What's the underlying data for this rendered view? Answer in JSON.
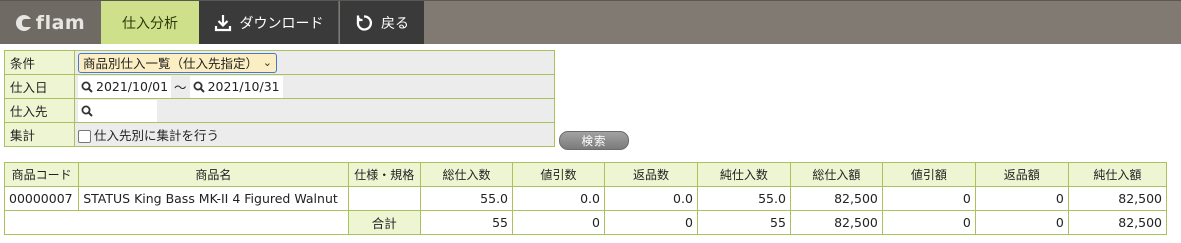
{
  "header": {
    "brand": "flam",
    "tabs": [
      {
        "label": "仕入分析",
        "active": true
      },
      {
        "label": "ダウンロード",
        "icon": "download-icon"
      },
      {
        "label": "戻る",
        "icon": "refresh-icon"
      }
    ]
  },
  "filter": {
    "condition_label": "条件",
    "condition_value": "商品別仕入一覧（仕入先指定）",
    "date_label": "仕入日",
    "date_from": "2021/10/01",
    "date_sep": "〜",
    "date_to": "2021/10/31",
    "supplier_label": "仕入先",
    "supplier_value": "",
    "aggregate_label": "集計",
    "aggregate_checkbox_label": "仕入先別に集計を行う",
    "aggregate_checked": false,
    "search_button": "検索"
  },
  "results": {
    "columns": [
      "商品コード",
      "商品名",
      "仕様・規格",
      "総仕入数",
      "値引数",
      "返品数",
      "純仕入数",
      "総仕入額",
      "値引額",
      "返品額",
      "純仕入額"
    ],
    "rows": [
      {
        "code": "00000007",
        "name": "STATUS King Bass MK-II 4 Figured Walnut",
        "spec": "",
        "total_qty": "55.0",
        "discount_qty": "0.0",
        "return_qty": "0.0",
        "net_qty": "55.0",
        "total_amount": "82,500",
        "discount_amount": "0",
        "return_amount": "0",
        "net_amount": "82,500"
      }
    ],
    "total": {
      "label": "合計",
      "total_qty": "55",
      "discount_qty": "0",
      "return_qty": "0",
      "net_qty": "55",
      "total_amount": "82,500",
      "discount_amount": "0",
      "return_amount": "0",
      "net_amount": "82,500"
    }
  },
  "colors": {
    "accent_green": "#cfe08b",
    "header_bg": "#807a73",
    "dark_tab": "#3a3a3a",
    "grid_border": "#a9c15e",
    "label_bg": "#eef5d2"
  }
}
